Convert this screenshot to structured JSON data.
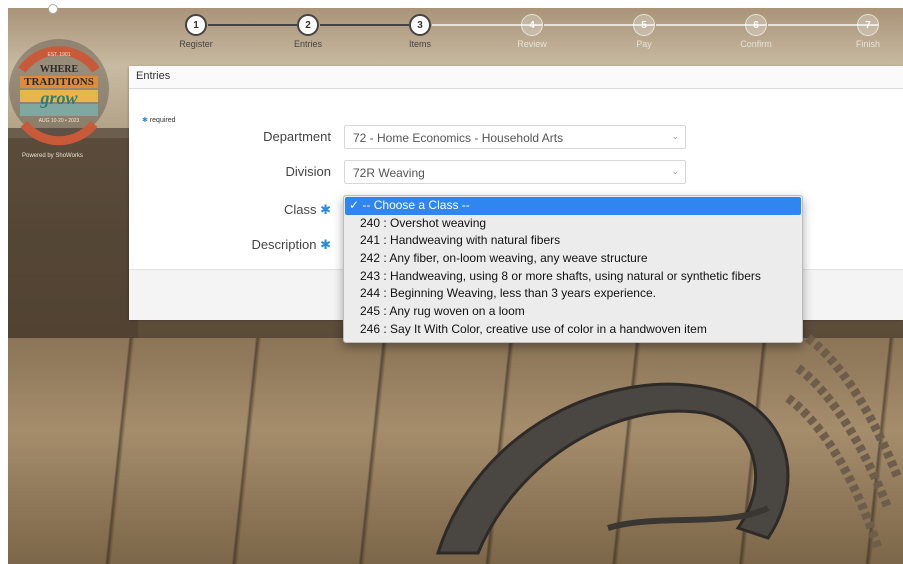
{
  "branding": {
    "est": "EST. 1901",
    "line1": "WHERE",
    "line2": "TRADITIONS",
    "line3": "grow",
    "dates": "AUG 10-20 • 2023",
    "powered_by": "Powered by ShoWorks"
  },
  "stepper": {
    "current": 3,
    "steps": [
      {
        "num": "1",
        "label": "Register",
        "state": "done"
      },
      {
        "num": "2",
        "label": "Entries",
        "state": "done"
      },
      {
        "num": "3",
        "label": "Items",
        "state": "done"
      },
      {
        "num": "4",
        "label": "Review",
        "state": "todo"
      },
      {
        "num": "5",
        "label": "Pay",
        "state": "todo"
      },
      {
        "num": "6",
        "label": "Confirm",
        "state": "todo"
      },
      {
        "num": "7",
        "label": "Finish",
        "state": "todo"
      }
    ]
  },
  "panel": {
    "title": "Entries",
    "required_note": "required"
  },
  "form": {
    "department_label": "Department",
    "department_value": "72 - Home Economics - Household Arts",
    "division_label": "Division",
    "division_value": "72R Weaving",
    "class_label": "Class",
    "description_label": "Description"
  },
  "class_dropdown": {
    "selected": "-- Choose a Class --",
    "options": [
      "240 : Overshot weaving",
      "241 : Handweaving with natural fibers",
      "242 : Any fiber, on-loom weaving, any weave structure",
      "243 : Handweaving, using 8 or more shafts, using natural or synthetic fibers",
      "244 : Beginning Weaving, less than 3 years experience.",
      "245 : Any rug woven on a loom",
      "246 : Say It With Color, creative use of color in a handwoven item"
    ]
  },
  "colors": {
    "accent": "#2a8bd8",
    "selected_option": "#2f86f0"
  }
}
